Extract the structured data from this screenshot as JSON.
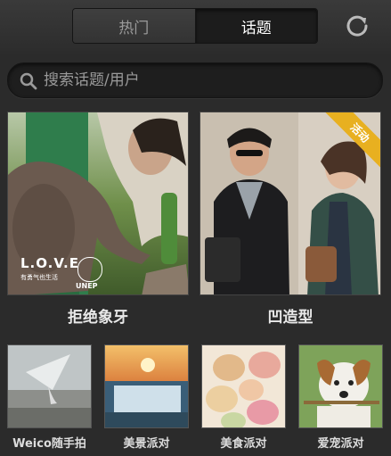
{
  "header": {
    "tabs": [
      {
        "label": "热门",
        "active": false
      },
      {
        "label": "话题",
        "active": true
      }
    ]
  },
  "search": {
    "placeholder": "搜索话题/用户"
  },
  "topics": [
    {
      "label": "拒绝象牙",
      "logo_text": "L.O.V.E",
      "logo_sub": "有勇气也生活",
      "org": "UNEP"
    },
    {
      "label": "凹造型",
      "badge": "活动"
    }
  ],
  "small_topics": [
    {
      "label": "Weico随手拍"
    },
    {
      "label": "美景派对"
    },
    {
      "label": "美食派对"
    },
    {
      "label": "爱宠派对"
    }
  ],
  "colors": {
    "background": "#2b2b2b",
    "badge": "#e8b020",
    "active_tab": "#1c1c1c"
  }
}
